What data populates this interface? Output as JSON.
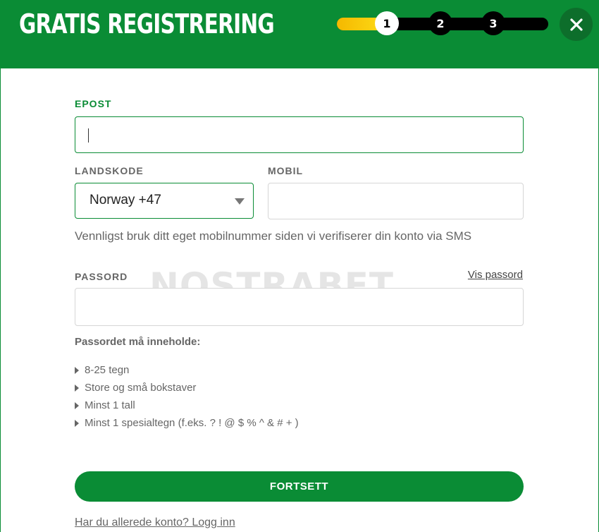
{
  "header": {
    "title": "GRATIS REGISTRERING",
    "steps": [
      "1",
      "2",
      "3"
    ],
    "current_step": 1,
    "progress_fill_fraction": 0.27,
    "close_icon": "close-icon"
  },
  "form": {
    "email": {
      "label": "EPOST",
      "value": ""
    },
    "country_code": {
      "label": "LANDSKODE",
      "selected": "Norway +47"
    },
    "mobile": {
      "label": "MOBIL",
      "value": ""
    },
    "mobile_hint": "Vennligst bruk ditt eget mobilnummer siden vi verifiserer din konto via SMS",
    "password": {
      "label": "PASSORD",
      "show_label": "Vis passord",
      "value": ""
    },
    "requirements_title": "Passordet må inneholde:",
    "requirements": [
      "8-25 tegn",
      "Store og små bokstaver",
      "Minst 1 tall",
      "Minst 1 spesialtegn (f.eks. ? ! @ $ % ^ & # + )"
    ],
    "submit_label": "FORTSETT",
    "login_link": "Har du allerede konto? Logg inn"
  },
  "watermark": "NOSTRABET",
  "colors": {
    "brand_green": "#0a8c35",
    "progress_yellow": "#ffe11a",
    "dark": "#000000"
  }
}
